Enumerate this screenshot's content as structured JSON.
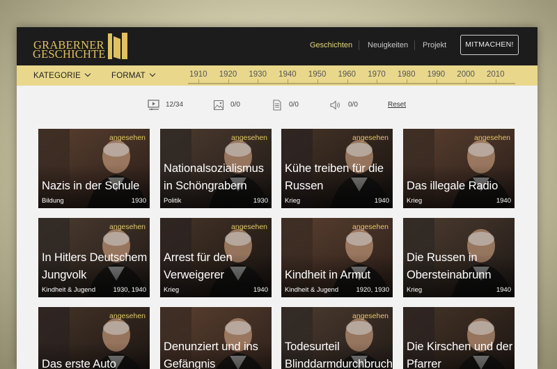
{
  "logo": {
    "line1": "GRABERNER",
    "line2": "GESCHICHTE"
  },
  "nav": [
    {
      "label": "Geschichten",
      "active": true
    },
    {
      "label": "Neuigkeiten",
      "active": false
    },
    {
      "label": "Projekt",
      "active": false
    }
  ],
  "join_label": "MITMACHEN!",
  "filters": {
    "category_label": "KATEGORIE",
    "format_label": "FORMAT"
  },
  "timeline_years": [
    "1910",
    "1920",
    "1930",
    "1940",
    "1950",
    "1960",
    "1970",
    "1980",
    "1990",
    "2000",
    "2010"
  ],
  "stats": [
    {
      "icon": "video-icon",
      "value": "12/34"
    },
    {
      "icon": "image-icon",
      "value": "0/0"
    },
    {
      "icon": "document-icon",
      "value": "0/0"
    },
    {
      "icon": "audio-icon",
      "value": "0/0"
    }
  ],
  "reset_label": "Reset",
  "badge_text": "angesehen",
  "colors": {
    "accent": "#e9d88c",
    "header": "#1c1c1c",
    "logo": "#e0c15f",
    "badge": "#e4c86a",
    "active_nav": "#e7d57d"
  },
  "cards": [
    {
      "title": "Nazis in der Schule",
      "category": "Bildung",
      "year": "1930",
      "viewed": true
    },
    {
      "title": "Nationalsozialismus in Schöngrabern",
      "category": "Politik",
      "year": "1930",
      "viewed": true
    },
    {
      "title": "Kühe treiben für die Russen",
      "category": "Krieg",
      "year": "1940",
      "viewed": true
    },
    {
      "title": "Das illegale Radio",
      "category": "Krieg",
      "year": "1940",
      "viewed": true
    },
    {
      "title": "In Hitlers Deutschem Jungvolk",
      "category": "Kindheit & Jugend",
      "year": "1930, 1940",
      "viewed": true
    },
    {
      "title": "Arrest für den Verweigerer",
      "category": "Krieg",
      "year": "1940",
      "viewed": true
    },
    {
      "title": "Kindheit in Armut",
      "category": "Kindheit & Jugend",
      "year": "1920, 1930",
      "viewed": true
    },
    {
      "title": "Die Russen in Obersteinabrunn",
      "category": "Krieg",
      "year": "1940",
      "viewed": false
    },
    {
      "title": "Das erste Auto",
      "category": "",
      "year": "",
      "viewed": true
    },
    {
      "title": "Denunziert und ins Gefängnis",
      "category": "",
      "year": "",
      "viewed": false
    },
    {
      "title": "Todesurteil Blinddarm­durchbruch",
      "category": "",
      "year": "",
      "viewed": true
    },
    {
      "title": "Die Kirschen und der Pfarrer",
      "category": "",
      "year": "",
      "viewed": false
    }
  ]
}
